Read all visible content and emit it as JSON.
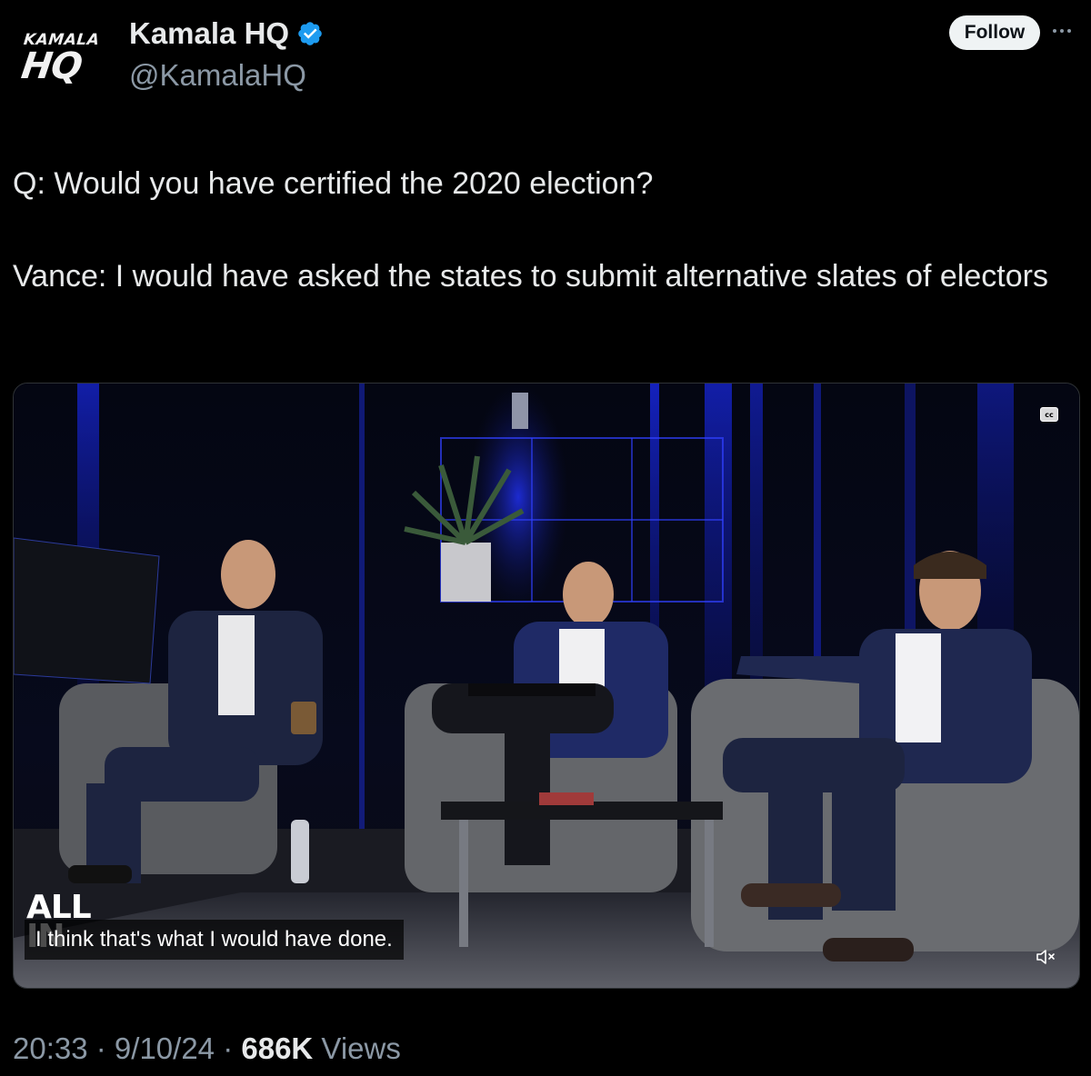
{
  "account": {
    "avatar_line1": "KAMALA",
    "avatar_line2": "HQ",
    "display_name": "Kamala HQ",
    "verified_icon": "verified-badge-icon",
    "handle": "@KamalaHQ"
  },
  "actions": {
    "follow_label": "Follow",
    "more_icon": "more-horizontal-icon"
  },
  "tweet": {
    "line1": "Q: Would you have certified the 2020 election?",
    "line2": "Vance: I would have asked the states to submit alternative slates of electors"
  },
  "video": {
    "cc_label": "cc",
    "watermark_line1": "ALL",
    "watermark_line2": "IN",
    "caption": "I think that's what I would have done.",
    "mute_icon": "muted-speaker-icon"
  },
  "meta": {
    "time": "20:33",
    "separator": " · ",
    "date": "9/10/24",
    "views_count": "686K",
    "views_label": " Views"
  },
  "colors": {
    "background": "#000000",
    "text_primary": "#e7e9ea",
    "text_secondary": "#8b98a5",
    "verified_blue": "#1d9bf0",
    "follow_button_bg": "#eff3f4"
  }
}
